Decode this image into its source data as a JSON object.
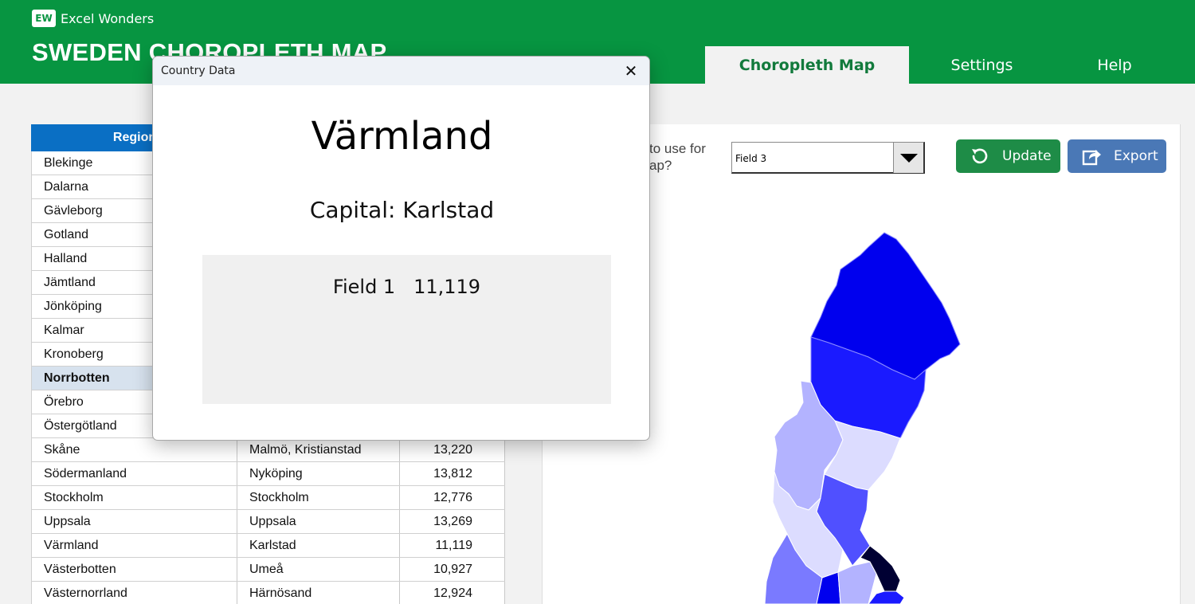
{
  "brand": {
    "badge": "EW",
    "name": "Excel Wonders"
  },
  "app_title": "SWEDEN CHOROPLETH MAP",
  "tabs": [
    {
      "label": "Choropleth Map",
      "active": true
    },
    {
      "label": "Settings",
      "active": false
    },
    {
      "label": "Help",
      "active": false
    }
  ],
  "table": {
    "header": "Region",
    "rows": [
      {
        "region": "Blekinge",
        "capital": "",
        "value": ""
      },
      {
        "region": "Dalarna",
        "capital": "",
        "value": ""
      },
      {
        "region": "Gävleborg",
        "capital": "",
        "value": ""
      },
      {
        "region": "Gotland",
        "capital": "",
        "value": ""
      },
      {
        "region": "Halland",
        "capital": "",
        "value": ""
      },
      {
        "region": "Jämtland",
        "capital": "",
        "value": ""
      },
      {
        "region": "Jönköping",
        "capital": "",
        "value": ""
      },
      {
        "region": "Kalmar",
        "capital": "",
        "value": ""
      },
      {
        "region": "Kronoberg",
        "capital": "",
        "value": ""
      },
      {
        "region": "Norrbotten",
        "capital": "",
        "value": "",
        "selected": true
      },
      {
        "region": "Örebro",
        "capital": "",
        "value": ""
      },
      {
        "region": "Östergötland",
        "capital": "",
        "value": ""
      },
      {
        "region": "Skåne",
        "capital": "Malmö, Kristianstad",
        "value": "13,220"
      },
      {
        "region": "Södermanland",
        "capital": "Nyköping",
        "value": "13,812"
      },
      {
        "region": "Stockholm",
        "capital": "Stockholm",
        "value": "12,776"
      },
      {
        "region": "Uppsala",
        "capital": "Uppsala",
        "value": "13,269"
      },
      {
        "region": "Värmland",
        "capital": "Karlstad",
        "value": "11,119"
      },
      {
        "region": "Västerbotten",
        "capital": "Umeå",
        "value": "10,927"
      },
      {
        "region": "Västernorrland",
        "capital": "Härnösand",
        "value": "12,924"
      }
    ]
  },
  "field_question": {
    "line1": "to use for",
    "line2": "ap?"
  },
  "field_select": {
    "value": "Field 3"
  },
  "buttons": {
    "update": "Update",
    "export": "Export"
  },
  "map": {
    "colors": {
      "dark_blue": "#0000ee",
      "blue": "#1a1aff",
      "medium": "#5050ff",
      "light": "#b3b3ff",
      "lighter": "#dcdcff",
      "mid": "#7a7aff",
      "navy": "#000033"
    }
  },
  "dialog": {
    "title": "Country Data",
    "region": "Värmland",
    "capital_line": "Capital: Karlstad",
    "field_label": "Field 1",
    "field_value": "11,119",
    "close_icon": "close-icon"
  },
  "colors": {
    "header_green": "#079541",
    "table_header_blue": "#0a6fc4",
    "update_green": "#1e8c47",
    "export_blue": "#4a78b6"
  }
}
